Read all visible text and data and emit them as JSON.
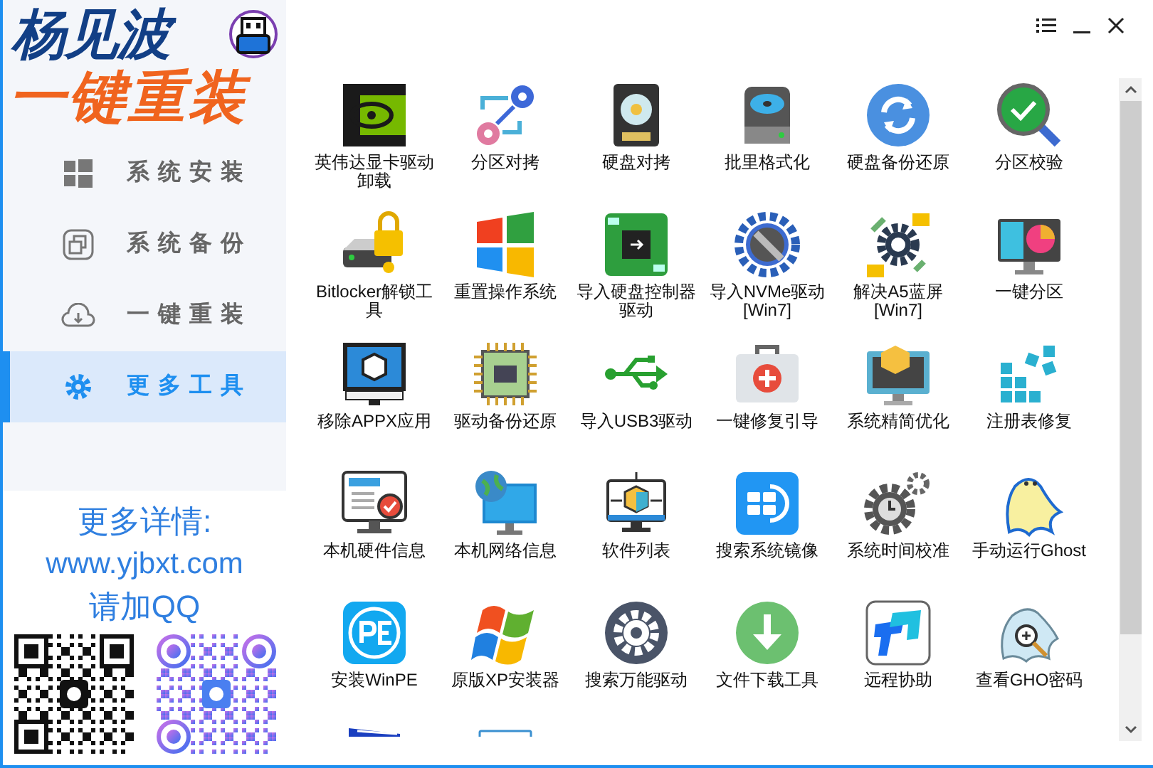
{
  "logo": {
    "name": "杨见波",
    "slogan": "一键重装"
  },
  "nav": [
    {
      "label": "系统安装",
      "selected": false
    },
    {
      "label": "系统备份",
      "selected": false
    },
    {
      "label": "一键重装",
      "selected": false
    },
    {
      "label": "更多工具",
      "selected": true
    }
  ],
  "contact": {
    "heading": "更多详情:",
    "url": "www.yjbxt.com",
    "qq": "请加QQ"
  },
  "tools": [
    {
      "label": "英伟达显卡驱动卸载"
    },
    {
      "label": "分区对拷"
    },
    {
      "label": "硬盘对拷"
    },
    {
      "label": "批里格式化"
    },
    {
      "label": "硬盘备份还原"
    },
    {
      "label": "分区校验"
    },
    {
      "label": "Bitlocker解锁工具"
    },
    {
      "label": "重置操作系统"
    },
    {
      "label": "导入硬盘控制器驱动"
    },
    {
      "label": "导入NVMe驱动[Win7]"
    },
    {
      "label": "解决A5蓝屏[Win7]"
    },
    {
      "label": "一键分区"
    },
    {
      "label": "移除APPX应用"
    },
    {
      "label": "驱动备份还原"
    },
    {
      "label": "导入USB3驱动"
    },
    {
      "label": "一键修复引导"
    },
    {
      "label": "系统精简优化"
    },
    {
      "label": "注册表修复"
    },
    {
      "label": "本机硬件信息"
    },
    {
      "label": "本机网络信息"
    },
    {
      "label": "软件列表"
    },
    {
      "label": "搜索系统镜像"
    },
    {
      "label": "系统时间校准"
    },
    {
      "label": "手动运行Ghost"
    },
    {
      "label": "安装WinPE"
    },
    {
      "label": "原版XP安装器"
    },
    {
      "label": "搜索万能驱动"
    },
    {
      "label": "文件下载工具"
    },
    {
      "label": "远程协助"
    },
    {
      "label": "查看GHO密码"
    }
  ]
}
